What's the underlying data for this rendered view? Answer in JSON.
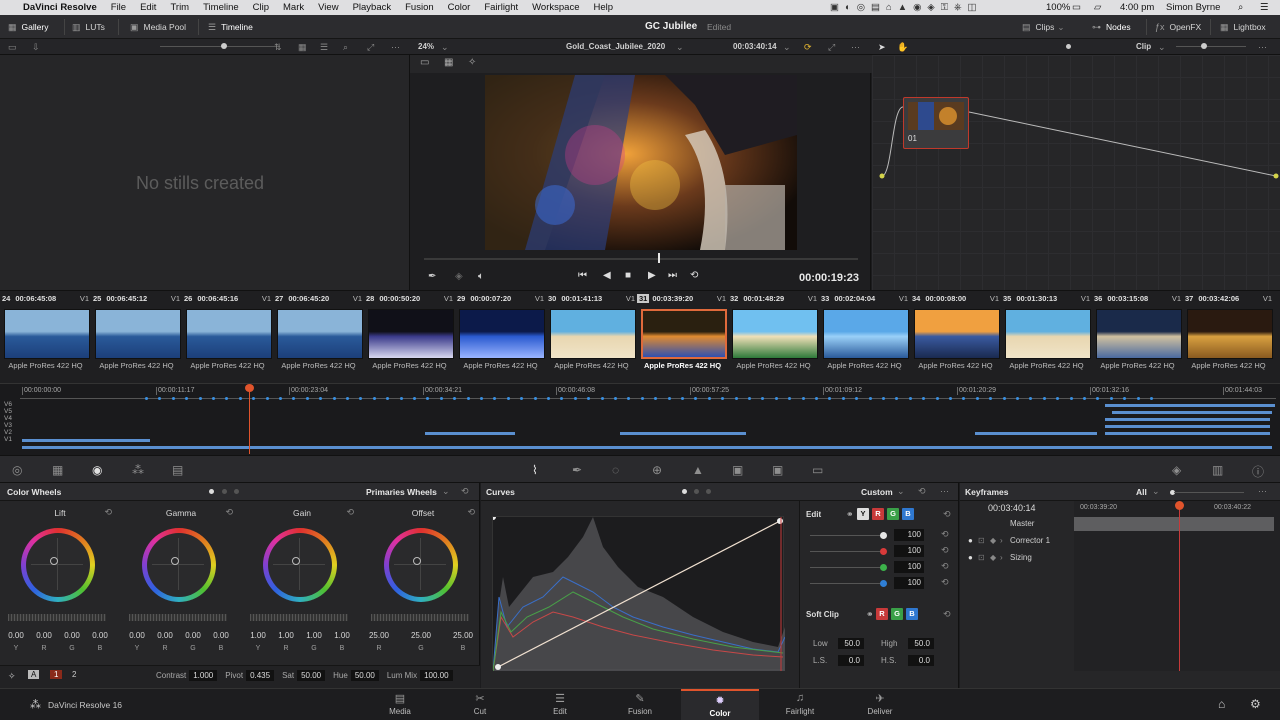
{
  "menubar": {
    "app": "DaVinci Resolve",
    "items": [
      "File",
      "Edit",
      "Trim",
      "Timeline",
      "Clip",
      "Mark",
      "View",
      "Playback",
      "Fusion",
      "Color",
      "Fairlight",
      "Workspace",
      "Help"
    ],
    "battery": "100%",
    "time": "4:00 pm",
    "user": "Simon Byrne"
  },
  "toolbar": {
    "gallery": "Gallery",
    "luts": "LUTs",
    "media_pool": "Media Pool",
    "timeline": "Timeline",
    "project_title": "GC Jubilee",
    "project_status": "Edited",
    "clips": "Clips",
    "nodes": "Nodes",
    "openfx": "OpenFX",
    "lightbox": "Lightbox"
  },
  "viewer": {
    "zoom": "24%",
    "timeline_name": "Gold_Coast_Jubilee_2020",
    "source_tc": "00:03:40:14",
    "current_tc": "00:00:19:23",
    "scrub_position": 0.55
  },
  "node_mode": "Clip",
  "gallery": {
    "empty_text": "No stills created"
  },
  "node": {
    "label": "01"
  },
  "clips": [
    {
      "num": "24",
      "tc": "00:06:45:08",
      "track": "V1",
      "codec": "Apple ProRes 422 HQ",
      "selected": false,
      "theme": "sea"
    },
    {
      "num": "25",
      "tc": "00:06:45:12",
      "track": "V1",
      "codec": "Apple ProRes 422 HQ",
      "selected": false,
      "theme": "sea"
    },
    {
      "num": "26",
      "tc": "00:06:45:16",
      "track": "V1",
      "codec": "Apple ProRes 422 HQ",
      "selected": false,
      "theme": "sea"
    },
    {
      "num": "27",
      "tc": "00:06:45:20",
      "track": "V1",
      "codec": "Apple ProRes 422 HQ",
      "selected": false,
      "theme": "sea"
    },
    {
      "num": "28",
      "tc": "00:00:50:20",
      "track": "V1",
      "codec": "Apple ProRes 422 HQ",
      "selected": false,
      "theme": "concert"
    },
    {
      "num": "29",
      "tc": "00:00:07:20",
      "track": "V1",
      "codec": "Apple ProRes 422 HQ",
      "selected": false,
      "theme": "concert2"
    },
    {
      "num": "30",
      "tc": "00:01:41:13",
      "track": "V1",
      "codec": "Apple ProRes 422 HQ",
      "selected": false,
      "theme": "beach"
    },
    {
      "num": "31",
      "tc": "00:03:39:20",
      "track": "V1",
      "codec": "Apple ProRes 422 HQ",
      "selected": true,
      "theme": "night"
    },
    {
      "num": "32",
      "tc": "00:01:48:29",
      "track": "V1",
      "codec": "Apple ProRes 422 HQ",
      "selected": false,
      "theme": "beach2"
    },
    {
      "num": "33",
      "tc": "00:02:04:04",
      "track": "V1",
      "codec": "Apple ProRes 422 HQ",
      "selected": false,
      "theme": "tower"
    },
    {
      "num": "34",
      "tc": "00:00:08:00",
      "track": "V1",
      "codec": "Apple ProRes 422 HQ",
      "selected": false,
      "theme": "sunset"
    },
    {
      "num": "35",
      "tc": "00:01:30:13",
      "track": "V1",
      "codec": "Apple ProRes 422 HQ",
      "selected": false,
      "theme": "beach"
    },
    {
      "num": "36",
      "tc": "00:03:15:08",
      "track": "V1",
      "codec": "Apple ProRes 422 HQ",
      "selected": false,
      "theme": "city"
    },
    {
      "num": "37",
      "tc": "00:03:42:06",
      "track": "V1",
      "codec": "Apple ProRes 422 HQ",
      "selected": false,
      "theme": "food"
    }
  ],
  "mini_timeline": {
    "ticks": [
      "00:00:00:00",
      "00:00:11:17",
      "00:00:23:04",
      "00:00:34:21",
      "00:00:46:08",
      "00:00:57:25",
      "00:01:09:12",
      "00:01:20:29",
      "00:01:32:16",
      "00:01:44:03"
    ],
    "tracks": [
      "V6",
      "V5",
      "V4",
      "V3",
      "V2",
      "V1"
    ]
  },
  "color_wheels": {
    "title": "Color Wheels",
    "mode": "Primaries Wheels",
    "wheels": [
      {
        "name": "Lift",
        "values": [
          "0.00",
          "0.00",
          "0.00",
          "0.00"
        ]
      },
      {
        "name": "Gamma",
        "values": [
          "0.00",
          "0.00",
          "0.00",
          "0.00"
        ]
      },
      {
        "name": "Gain",
        "values": [
          "1.00",
          "1.00",
          "1.00",
          "1.00"
        ]
      },
      {
        "name": "Offset",
        "values": [
          "25.00",
          "25.00",
          "25.00"
        ]
      }
    ],
    "labels4": [
      "Y",
      "R",
      "G",
      "B"
    ],
    "labels3": [
      "R",
      "G",
      "B"
    ],
    "page_a": "1",
    "page_b": "2",
    "contrast_label": "Contrast",
    "contrast": "1.000",
    "pivot_label": "Pivot",
    "pivot": "0.435",
    "sat_label": "Sat",
    "sat": "50.00",
    "hue_label": "Hue",
    "hue": "50.00",
    "lummix_label": "Lum Mix",
    "lummix": "100.00"
  },
  "curves": {
    "title": "Curves",
    "mode": "Custom",
    "edit_label": "Edit",
    "channels": [
      "Y",
      "R",
      "G",
      "B"
    ],
    "edit_values": [
      {
        "color": "#e6e6e6",
        "value": "100"
      },
      {
        "color": "#d83a3a",
        "value": "100"
      },
      {
        "color": "#3cb24a",
        "value": "100"
      },
      {
        "color": "#2f7fd6",
        "value": "100"
      }
    ],
    "soft_clip_label": "Soft Clip",
    "low_label": "Low",
    "low": "50.0",
    "high_label": "High",
    "high": "50.0",
    "ls_label": "L.S.",
    "ls": "0.0",
    "hs_label": "H.S.",
    "hs": "0.0"
  },
  "keyframes": {
    "title": "Keyframes",
    "filter": "All",
    "tc": "00:03:40:14",
    "ruler_a": "00:03:39:20",
    "ruler_b": "00:03:40:22",
    "rows": [
      "Master",
      "Corrector 1",
      "Sizing"
    ]
  },
  "pages": [
    {
      "name": "Media",
      "icon": "▤"
    },
    {
      "name": "Cut",
      "icon": "✂"
    },
    {
      "name": "Edit",
      "icon": "☰"
    },
    {
      "name": "Fusion",
      "icon": "✎"
    },
    {
      "name": "Color",
      "icon": "✹"
    },
    {
      "name": "Fairlight",
      "icon": "♫"
    },
    {
      "name": "Deliver",
      "icon": "✈"
    }
  ],
  "active_page": "Color",
  "brand": "DaVinci Resolve 16"
}
